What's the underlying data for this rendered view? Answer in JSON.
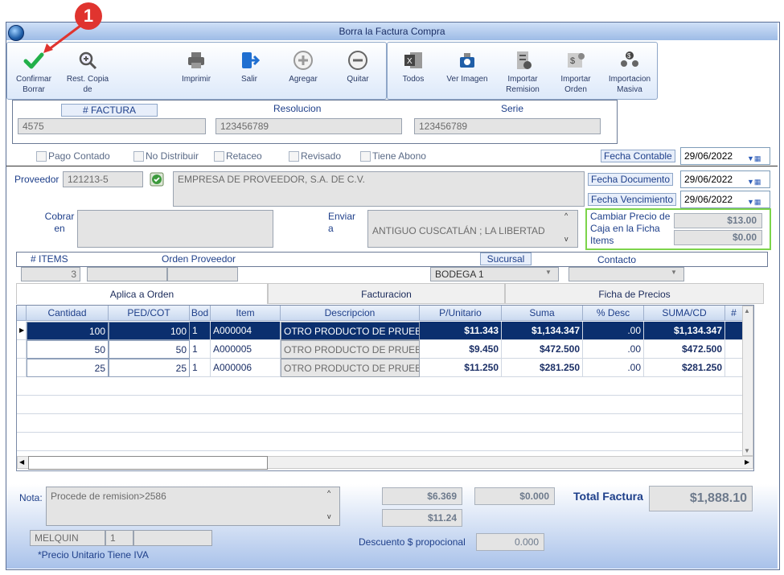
{
  "window": {
    "title": "Borra la  Factura Compra"
  },
  "callout": {
    "number": "1"
  },
  "toolbar": {
    "confirm": "Confirmar Borrar",
    "rest": "Rest. Copia de",
    "print": "Imprimir",
    "exit": "Salir",
    "add": "Agregar",
    "remove": "Quitar",
    "all": "Todos",
    "image": "Ver Imagen",
    "import_remision": "Importar Remision",
    "import_orden": "Importar Orden",
    "import_masiva": "Importacion Masiva"
  },
  "header": {
    "factura_label": "# FACTURA",
    "factura_value": "4575",
    "resolucion_label": "Resolucion",
    "resolucion_value": "123456789",
    "serie_label": "Serie",
    "serie_value": "123456789"
  },
  "checks": {
    "pago": "Pago Contado",
    "nodist": "No Distribuir",
    "retaceo": "Retaceo",
    "revisado": "Revisado",
    "abono": "Tiene Abono"
  },
  "fechas": {
    "contable_label": "Fecha Contable",
    "contable_value": "29/06/2022",
    "documento_label": "Fecha Documento",
    "documento_value": "29/06/2022",
    "vencimiento_label": "Fecha Vencimiento",
    "vencimiento_value": "29/06/2022"
  },
  "proveedor": {
    "label": "Proveedor",
    "code": "121213-5",
    "name": "EMPRESA DE PROVEEDOR, S.A. DE C.V."
  },
  "cobrar": {
    "label": "Cobrar en"
  },
  "enviar": {
    "label": "Enviar a",
    "value": "ANTIGUO CUSCATLÁN ; LA LIBERTAD"
  },
  "precio": {
    "label": "Cambiar Precio de Caja en la Ficha Items",
    "v1": "$13.00",
    "v2": "$0.00"
  },
  "info": {
    "items_label": "# ITEMS",
    "items_value": "3",
    "orden_label": "Orden Proveedor",
    "sucursal_label": "Sucursal",
    "sucursal_value": "BODEGA 1",
    "contacto_label": "Contacto"
  },
  "tabs": [
    "Aplica a Orden",
    "Facturacion",
    "Ficha de Precios"
  ],
  "grid": {
    "headers": [
      "Cantidad",
      "PED/COT",
      "Bod",
      "Item",
      "Descripcion",
      "P/Unitario",
      "Suma",
      "% Desc",
      "SUMA/CD",
      "# LOT"
    ],
    "rows": [
      {
        "cantidad": "100",
        "ped": "100",
        "bod": "1",
        "item": "A000004",
        "desc": "OTRO PRODUCTO DE PRUEBA",
        "pu": "$11.343",
        "suma": "$1,134.347",
        "pdesc": ".00",
        "sumacd": "$1,134.347"
      },
      {
        "cantidad": "50",
        "ped": "50",
        "bod": "1",
        "item": "A000005",
        "desc": "OTRO PRODUCTO DE PRUEBA",
        "pu": "$9.450",
        "suma": "$472.500",
        "pdesc": ".00",
        "sumacd": "$472.500"
      },
      {
        "cantidad": "25",
        "ped": "25",
        "bod": "1",
        "item": "A000006",
        "desc": "OTRO PRODUCTO DE PRUEBA",
        "pu": "$11.250",
        "suma": "$281.250",
        "pdesc": ".00",
        "sumacd": "$281.250"
      }
    ]
  },
  "footer": {
    "nota_label": "Nota:",
    "nota_value": "Procede de remision>2586",
    "s1": "$6.369",
    "s2": "$0.000",
    "s3": "$11.24",
    "total_label": "Total Factura",
    "total_value": "$1,888.10",
    "desc_label": "Descuento $ propocional",
    "desc_value": "0.000",
    "user": "MELQUIN",
    "user_num": "1",
    "note_iva": "*Precio Unitario Tiene IVA"
  }
}
